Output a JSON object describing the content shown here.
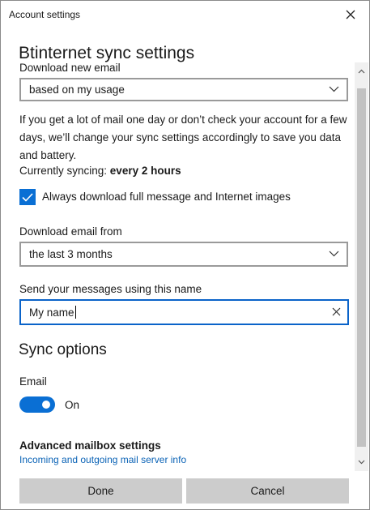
{
  "window": {
    "title": "Account settings"
  },
  "heading": "Btinternet sync settings",
  "download_new_email": {
    "label": "Download new email",
    "selected": "based on my usage"
  },
  "info_paragraph": "If you get a lot of mail one day or don’t check your account for a few days, we’ll change your sync settings accordingly to save you data and battery.",
  "currently_syncing": {
    "prefix": "Currently syncing: ",
    "value": "every 2 hours"
  },
  "full_message_checkbox": {
    "label": "Always download full message and Internet images",
    "checked": true
  },
  "download_email_from": {
    "label": "Download email from",
    "selected": "the last 3 months"
  },
  "send_name": {
    "label": "Send your messages using this name",
    "value": "My name"
  },
  "sync_options": {
    "heading": "Sync options",
    "email_label": "Email",
    "toggle_state": "On",
    "toggle_on": true
  },
  "advanced": {
    "title": "Advanced mailbox settings",
    "link": "Incoming and outgoing mail server info"
  },
  "buttons": {
    "done": "Done",
    "cancel": "Cancel"
  },
  "colors": {
    "accent": "#0a6fd4",
    "link": "#0b63b6",
    "button_bg": "#cccccc"
  }
}
